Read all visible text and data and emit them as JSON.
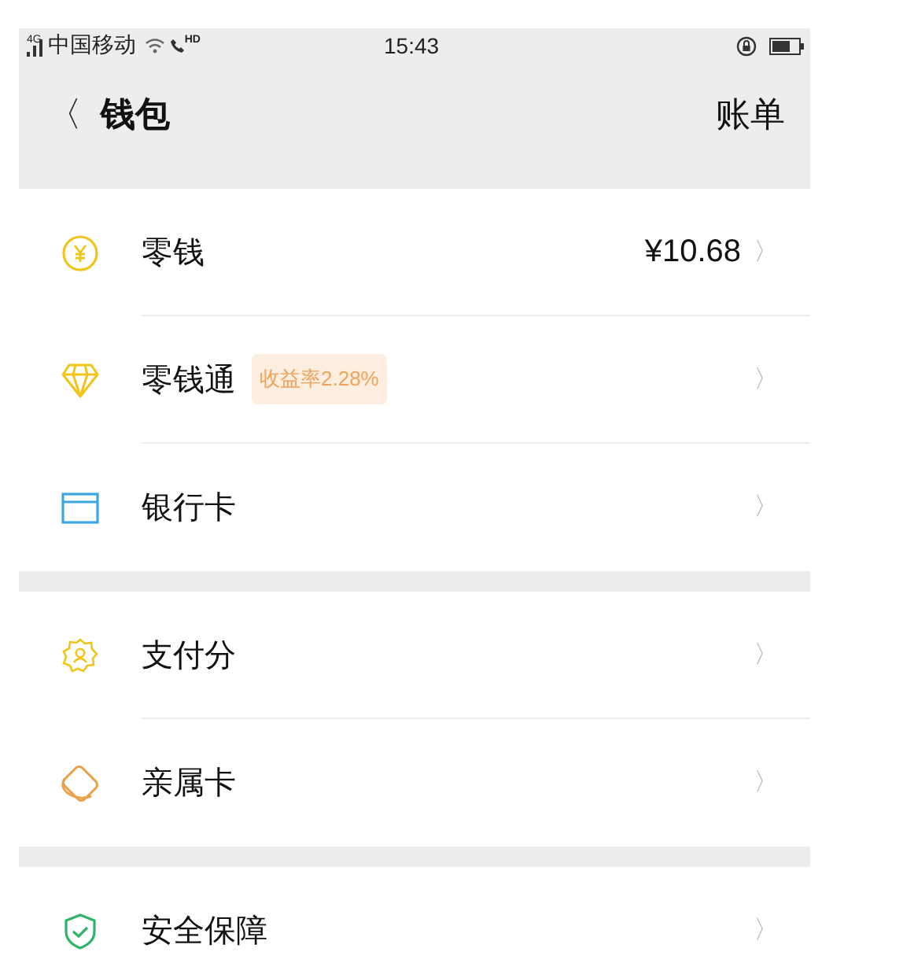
{
  "status_bar": {
    "network": "4G",
    "carrier": "中国移动",
    "call_badge": "HD",
    "time": "15:43"
  },
  "nav": {
    "back": "〈",
    "title": "钱包",
    "action": "账单"
  },
  "sections": [
    {
      "items": [
        {
          "kind": "coin",
          "label": "零钱",
          "value": "¥10.68",
          "chevron": "〉"
        },
        {
          "kind": "diamond",
          "label": "零钱通",
          "badge": "收益率2.28%",
          "chevron": "〉"
        },
        {
          "kind": "card",
          "label": "银行卡",
          "chevron": "〉"
        }
      ]
    },
    {
      "items": [
        {
          "kind": "score",
          "label": "支付分",
          "chevron": "〉"
        },
        {
          "kind": "family",
          "label": "亲属卡",
          "chevron": "〉"
        }
      ]
    },
    {
      "items": [
        {
          "kind": "shield",
          "label": "安全保障",
          "chevron": "〉"
        }
      ]
    }
  ]
}
